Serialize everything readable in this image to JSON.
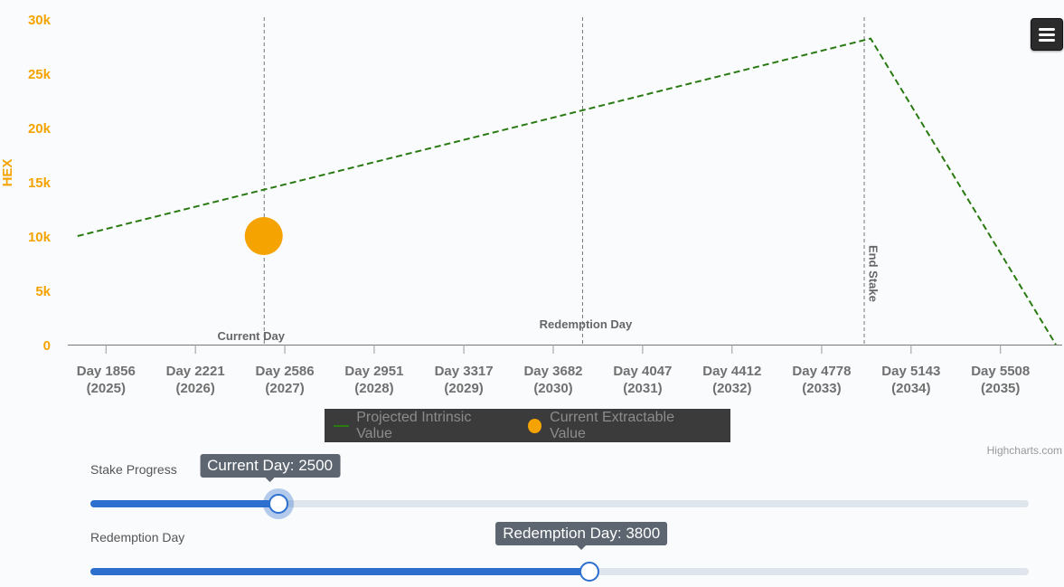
{
  "chart_data": {
    "type": "line",
    "ylabel": "HEX",
    "ylim": [
      0,
      30000
    ],
    "y_ticks": [
      0,
      5000,
      10000,
      15000,
      20000,
      25000,
      30000
    ],
    "y_tick_labels": [
      "0",
      "5k",
      "10k",
      "15k",
      "20k",
      "25k",
      "30k"
    ],
    "xlim": [
      1700,
      5760
    ],
    "x_ticks": [
      {
        "day": 1856,
        "label": "Day 1856",
        "sub": "(2025)"
      },
      {
        "day": 2221,
        "label": "Day 2221",
        "sub": "(2026)"
      },
      {
        "day": 2586,
        "label": "Day 2586",
        "sub": "(2027)"
      },
      {
        "day": 2951,
        "label": "Day 2951",
        "sub": "(2028)"
      },
      {
        "day": 3317,
        "label": "Day 3317",
        "sub": "(2029)"
      },
      {
        "day": 3682,
        "label": "Day 3682",
        "sub": "(2030)"
      },
      {
        "day": 4047,
        "label": "Day 4047",
        "sub": "(2031)"
      },
      {
        "day": 4412,
        "label": "Day 4412",
        "sub": "(2032)"
      },
      {
        "day": 4778,
        "label": "Day 4778",
        "sub": "(2033)"
      },
      {
        "day": 5143,
        "label": "Day 5143",
        "sub": "(2034)"
      },
      {
        "day": 5508,
        "label": "Day 5508",
        "sub": "(2035)"
      }
    ],
    "series": [
      {
        "name": "Projected Intrinsic Value",
        "type": "line",
        "dash": true,
        "color": "#2a7a12",
        "points": [
          [
            1740,
            10000
          ],
          [
            4978,
            28200
          ],
          [
            5734,
            0
          ]
        ]
      },
      {
        "name": "Current Extractable Value",
        "type": "scatter",
        "color": "#f5a300",
        "points": [
          [
            2500,
            10000
          ]
        ]
      }
    ],
    "plot_lines": [
      {
        "day": 2500,
        "label": "Current Day"
      },
      {
        "day": 3800,
        "label": "Redemption Day"
      },
      {
        "day": 4950,
        "label": "End Stake"
      }
    ],
    "grid": false,
    "legend": "bottom-center",
    "axis_color": "#f5a300"
  },
  "legend": {
    "items": [
      {
        "label": "Projected Intrinsic Value"
      },
      {
        "label": "Current Extractable Value"
      }
    ]
  },
  "credits": "Highcharts.com",
  "menu": {
    "icon": "hamburger-menu-icon"
  },
  "sliders": {
    "stake_progress": {
      "label": "Stake Progress",
      "tooltip": "Current Day: 2500",
      "value_fraction": 0.2
    },
    "redemption_day": {
      "label": "Redemption Day",
      "tooltip": "Redemption Day: 3800",
      "value_fraction": 0.532
    }
  },
  "colors": {
    "accent": "#2d6fce",
    "projected": "#2a7a12",
    "current": "#f5a300"
  }
}
